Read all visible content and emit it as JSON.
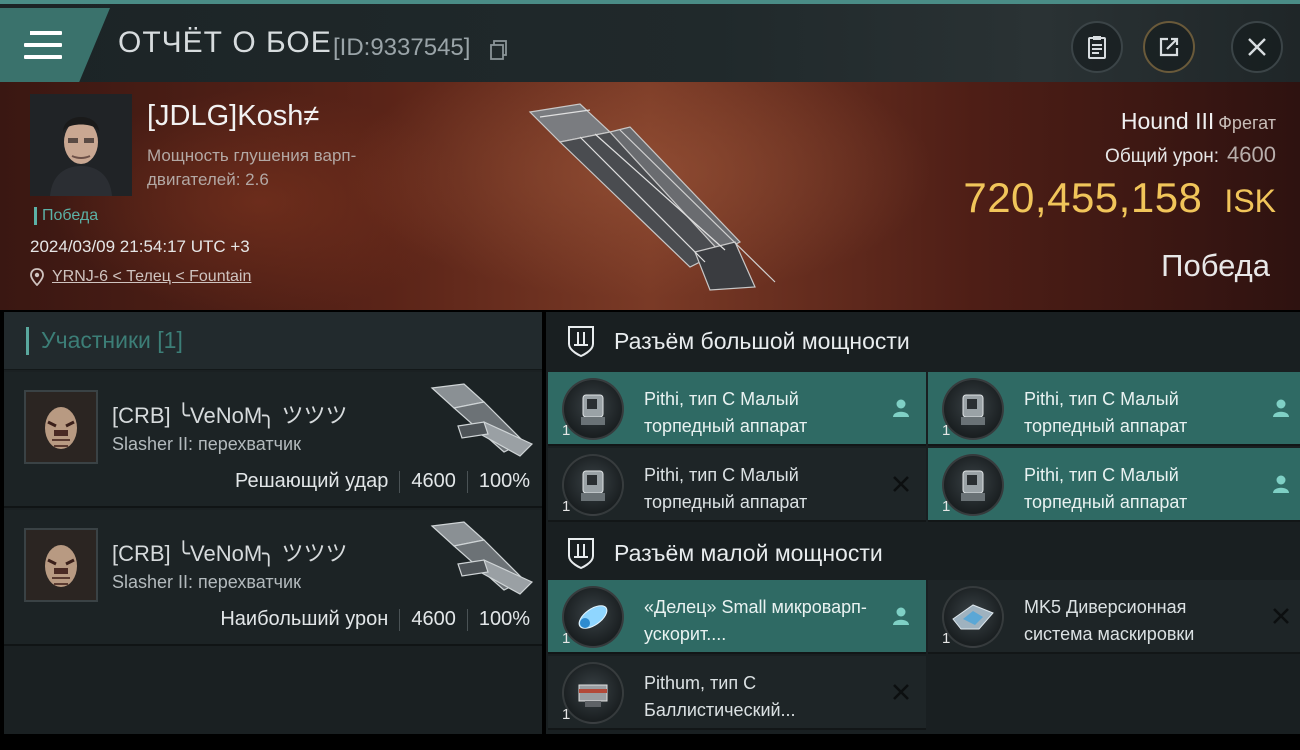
{
  "header": {
    "title": "ОТЧЁТ О БОЕ",
    "id_text": "[ID:9337545]",
    "icons": [
      "menu-icon",
      "clipboard-icon",
      "share-icon",
      "close-icon"
    ]
  },
  "victim": {
    "name": "[JDLG]Kosh≠",
    "stat": "Мощность глушения варп-двигателей: 2.6",
    "tag": "Победа",
    "datetime": "2024/03/09 21:54:17 UTC +3",
    "location": "YRNJ-6 < Телец < Fountain",
    "ship_name": "Hound III",
    "ship_class": "Фрегат",
    "damage_label": "Общий урон:",
    "damage_value": "4600",
    "isk_value": "720,455,158",
    "isk_unit": "ISK",
    "result": "Победа"
  },
  "participants": {
    "header": "Участники [1]",
    "items": [
      {
        "name": "[CRB] ╰VeNoM╮ ツツツ",
        "ship": "Slasher II: перехватчик",
        "role": "Решающий удар",
        "damage": "4600",
        "percent": "100%"
      },
      {
        "name": "[CRB] ╰VeNoM╮ ツツツ",
        "ship": "Slasher II: перехватчик",
        "role": "Наибольший урон",
        "damage": "4600",
        "percent": "100%"
      }
    ]
  },
  "fitting": {
    "high_title": "Разъём большой мощности",
    "low_title": "Разъём малой мощности",
    "high_slots": [
      {
        "name": "Pithi, тип C Малый торпедный аппарат",
        "qty": "1",
        "status": "pilot-icon",
        "active": true
      },
      {
        "name": "Pithi, тип C Малый торпедный аппарат",
        "qty": "1",
        "status": "pilot-icon",
        "active": true
      },
      {
        "name": "Pithi, тип C Малый торпедный аппарат",
        "qty": "1",
        "status": "destroyed-icon",
        "active": false
      },
      {
        "name": "Pithi, тип C Малый торпедный аппарат",
        "qty": "1",
        "status": "pilot-icon",
        "active": true
      }
    ],
    "low_slots": [
      {
        "name": "«Делец» Small микроварп-ускорит....",
        "qty": "1",
        "status": "pilot-icon",
        "active": true
      },
      {
        "name": "MK5 Диверсионная система маскировки",
        "qty": "1",
        "status": "destroyed-icon",
        "active": false
      },
      {
        "name": "Pithum, тип C Баллистический...",
        "qty": "1",
        "status": "destroyed-icon",
        "active": false
      }
    ]
  },
  "colors": {
    "accent": "#3a726c",
    "isk": "#f1c55a",
    "victory": "#5cb1a6"
  }
}
